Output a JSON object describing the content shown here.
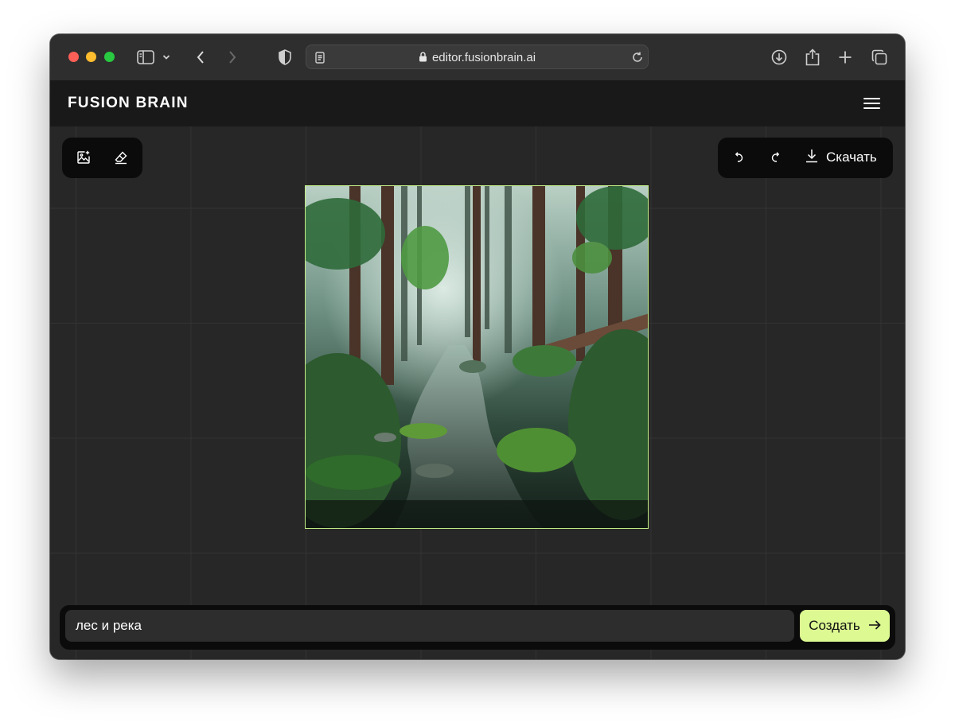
{
  "browser": {
    "url": "editor.fusionbrain.ai",
    "icons": [
      "sidebar-icon",
      "chevron-down-icon",
      "back-icon",
      "forward-icon",
      "shield-icon",
      "reader-icon",
      "lock-icon",
      "reload-icon",
      "download-icon",
      "share-icon",
      "new-tab-icon",
      "tabs-overview-icon"
    ]
  },
  "header": {
    "logo": "FUSION BRAIN",
    "menu_icon": "hamburger-menu-icon"
  },
  "toolbar_left": {
    "icons": [
      "add-image-icon",
      "eraser-icon"
    ]
  },
  "toolbar_right": {
    "download_label": "Скачать",
    "icons": [
      "undo-icon",
      "redo-icon",
      "download-icon"
    ]
  },
  "canvas": {
    "image_description_icon": "generated-image"
  },
  "prompt": {
    "value": "лес и река",
    "create_label": "Создать"
  },
  "colors": {
    "accent": "#dcf992",
    "image_border": "#c4ee86",
    "header_bg": "#191919",
    "canvas_bg": "#272727"
  }
}
